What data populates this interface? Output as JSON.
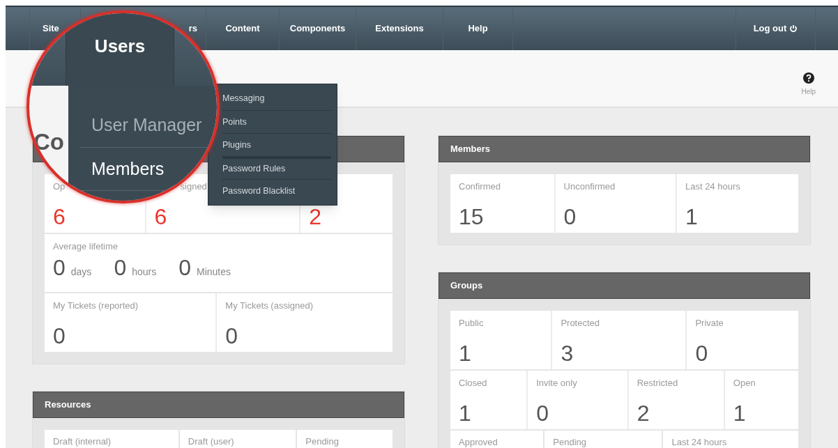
{
  "nav": {
    "items": [
      {
        "label": "Site",
        "covered_start": false
      },
      {
        "label": "rs",
        "covered_start": true
      },
      {
        "label": "Content",
        "covered_start": false
      },
      {
        "label": "Components",
        "covered_start": false
      },
      {
        "label": "Extensions",
        "covered_start": false
      },
      {
        "label": "Help",
        "covered_start": false
      }
    ],
    "logout": "Log out"
  },
  "toolbar": {
    "help_label": "Help"
  },
  "magnifier": {
    "tab": "Users",
    "title_fragment": "Co",
    "menu": [
      {
        "label": "User Manager",
        "disabled": true
      },
      {
        "label": "Members",
        "disabled": false
      }
    ]
  },
  "submenu": {
    "items": [
      {
        "label": "Messaging",
        "separator_before": false
      },
      {
        "label": "Points",
        "separator_before": false
      },
      {
        "label": "Plugins",
        "separator_before": false
      },
      {
        "label": "Password Rules",
        "separator_before": true
      },
      {
        "label": "Password Blacklist",
        "separator_before": false
      }
    ]
  },
  "tickets": {
    "rows": [
      {
        "kind": "cells",
        "cells": [
          {
            "label": "Op",
            "value": "6",
            "alert": true,
            "covered_start": false
          },
          {
            "label": "signed",
            "value": "6",
            "alert": true,
            "covered_start": true
          },
          {
            "value": "2",
            "alert": true
          }
        ]
      },
      {
        "kind": "duration",
        "label": "Average lifetime",
        "parts": [
          {
            "value": "0",
            "unit": "days"
          },
          {
            "value": "0",
            "unit": "hours"
          },
          {
            "value": "0",
            "unit": "Minutes"
          }
        ]
      },
      {
        "kind": "cells",
        "cells": [
          {
            "label": "My Tickets (reported)",
            "value": "0",
            "alert": false,
            "covered_start": false
          },
          {
            "label": "My Tickets (assigned)",
            "value": "0",
            "alert": false,
            "covered_start": false
          }
        ]
      }
    ]
  },
  "resources": {
    "title": "Resources",
    "columns": [
      "Draft (internal)",
      "Draft (user)",
      "Pending"
    ]
  },
  "members": {
    "title": "Members",
    "rows": [
      {
        "kind": "cells",
        "cells": [
          {
            "label": "Confirmed",
            "value": "15",
            "alert": false,
            "covered_start": false
          },
          {
            "label": "Unconfirmed",
            "value": "0",
            "alert": false,
            "covered_start": false
          },
          {
            "label": "Last 24 hours",
            "value": "1",
            "alert": false,
            "covered_start": false
          }
        ]
      }
    ]
  },
  "groups": {
    "title": "Groups",
    "rows": [
      {
        "kind": "cells",
        "cells": [
          {
            "label": "Public",
            "value": "1",
            "alert": false,
            "covered_start": false
          },
          {
            "label": "Protected",
            "value": "3",
            "alert": false,
            "covered_start": false
          },
          {
            "label": "Private",
            "value": "0",
            "alert": false,
            "covered_start": false
          }
        ]
      },
      {
        "kind": "cells",
        "cells": [
          {
            "label": "Closed",
            "value": "1",
            "alert": false,
            "covered_start": false
          },
          {
            "label": "Invite only",
            "value": "0",
            "alert": false,
            "covered_start": false
          },
          {
            "label": "Restricted",
            "value": "2",
            "alert": false,
            "covered_start": false
          },
          {
            "label": "Open",
            "value": "1",
            "alert": false,
            "covered_start": false
          }
        ]
      }
    ],
    "footer_labels": [
      "Approved",
      "Pending",
      "Last 24 hours"
    ]
  }
}
